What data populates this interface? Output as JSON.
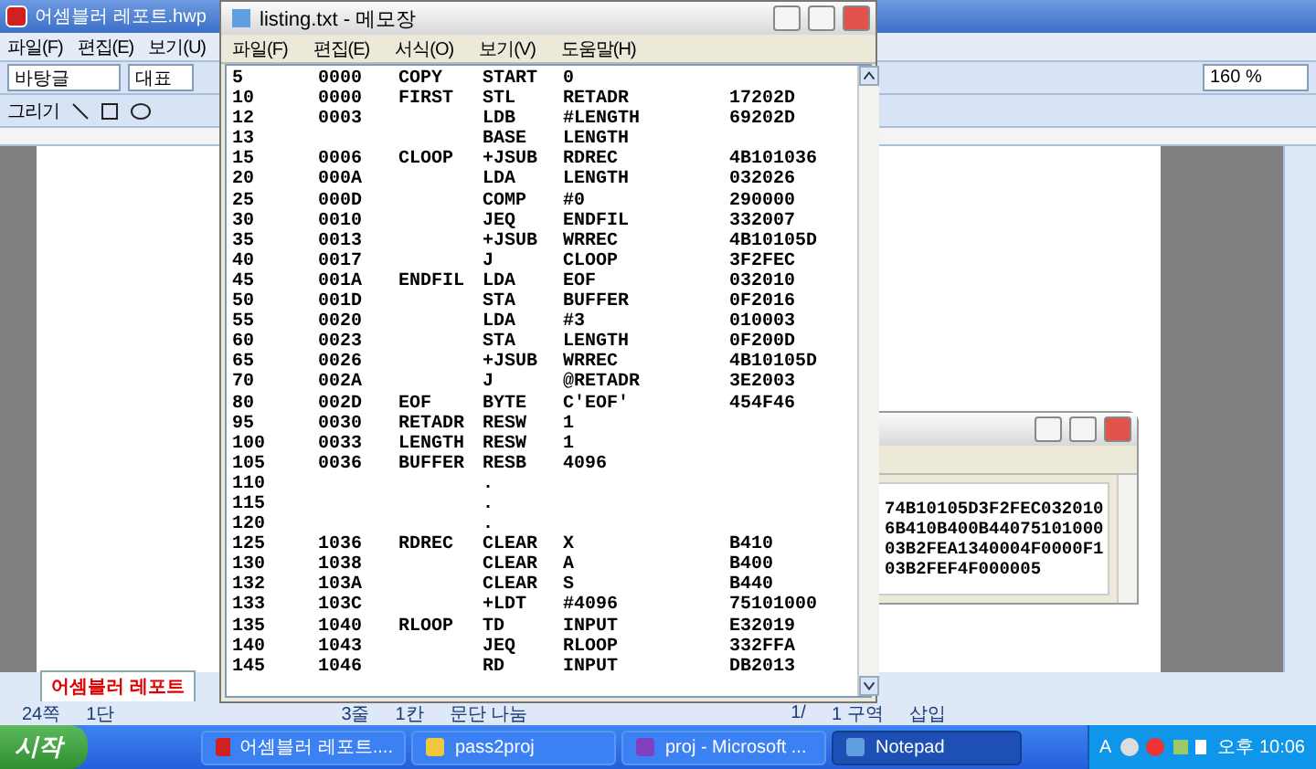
{
  "editor_window": {
    "title": "어셈블러 레포트.hwp",
    "menu": [
      "파일(F)",
      "편집(E)",
      "보기(U)"
    ],
    "style_field": "바탕글",
    "font_field": "대표",
    "draw_label": "그리기",
    "zoom_field": "160 %",
    "doc_tab": {
      "label": "어셈블러 레포트",
      "selected": true
    },
    "status_bar": [
      "24쪽",
      "1단",
      "3줄",
      "1칸",
      "문단 나눔",
      "1/",
      "1 구역",
      "삽입"
    ]
  },
  "notepad": {
    "title": "listing.txt - 메모장",
    "menu": [
      "파일(F)",
      "편집(E)",
      "서식(O)",
      "보기(V)",
      "도움말(H)"
    ],
    "rows": [
      {
        "line": "5",
        "loc": "0000",
        "label": "COPY",
        "op": "START",
        "operand": "0"
      },
      {
        "line": "10",
        "loc": "0000",
        "label": "FIRST",
        "op": "STL",
        "operand": "RETADR",
        "object_code": "17202D"
      },
      {
        "line": "12",
        "loc": "0003",
        "op": "LDB",
        "operand": "#LENGTH",
        "object_code": "69202D"
      },
      {
        "line": "13",
        "op": "BASE",
        "operand": "LENGTH"
      },
      {
        "line": "15",
        "loc": "0006",
        "label": "CLOOP",
        "op": "+JSUB",
        "operand": "RDREC",
        "object_code": "4B101036"
      },
      {
        "line": "20",
        "loc": "000A",
        "op": "LDA",
        "operand": "LENGTH",
        "object_code": "032026"
      },
      {
        "line": "25",
        "loc": "000D",
        "op": "COMP",
        "operand": "#0",
        "object_code": "290000"
      },
      {
        "line": "30",
        "loc": "0010",
        "op": "JEQ",
        "operand": "ENDFIL",
        "object_code": "332007"
      },
      {
        "line": "35",
        "loc": "0013",
        "op": "+JSUB",
        "operand": "WRREC",
        "object_code": "4B10105D"
      },
      {
        "line": "40",
        "loc": "0017",
        "op": "J",
        "operand": "CLOOP",
        "object_code": "3F2FEC"
      },
      {
        "line": "45",
        "loc": "001A",
        "label": "ENDFIL",
        "op": "LDA",
        "operand": "EOF",
        "object_code": "032010"
      },
      {
        "line": "50",
        "loc": "001D",
        "op": "STA",
        "operand": "BUFFER",
        "object_code": "0F2016"
      },
      {
        "line": "55",
        "loc": "0020",
        "op": "LDA",
        "operand": "#3",
        "object_code": "010003"
      },
      {
        "line": "60",
        "loc": "0023",
        "op": "STA",
        "operand": "LENGTH",
        "object_code": "0F200D"
      },
      {
        "line": "65",
        "loc": "0026",
        "op": "+JSUB",
        "operand": "WRREC",
        "object_code": "4B10105D"
      },
      {
        "line": "70",
        "loc": "002A",
        "op": "J",
        "operand": "@RETADR",
        "object_code": "3E2003"
      },
      {
        "line": "80",
        "loc": "002D",
        "label": "EOF",
        "op": "BYTE",
        "operand": "C'EOF'",
        "object_code": "454F46"
      },
      {
        "line": "95",
        "loc": "0030",
        "label": "RETADR",
        "op": "RESW",
        "operand": "1"
      },
      {
        "line": "100",
        "loc": "0033",
        "label": "LENGTH",
        "op": "RESW",
        "operand": "1"
      },
      {
        "line": "105",
        "loc": "0036",
        "label": "BUFFER",
        "op": "RESB",
        "operand": "4096"
      },
      {
        "line": "110",
        "op": "."
      },
      {
        "line": "115",
        "op": "."
      },
      {
        "line": "120",
        "op": "."
      },
      {
        "line": "125",
        "loc": "1036",
        "label": "RDREC",
        "op": "CLEAR",
        "operand": "X",
        "object_code": "B410"
      },
      {
        "line": "130",
        "loc": "1038",
        "op": "CLEAR",
        "operand": "A",
        "object_code": "B400"
      },
      {
        "line": "132",
        "loc": "103A",
        "op": "CLEAR",
        "operand": "S",
        "object_code": "B440"
      },
      {
        "line": "133",
        "loc": "103C",
        "op": "+LDT",
        "operand": "#4096",
        "object_code": "75101000"
      },
      {
        "line": "135",
        "loc": "1040",
        "label": "RLOOP",
        "op": "TD",
        "operand": "INPUT",
        "object_code": "E32019"
      },
      {
        "line": "140",
        "loc": "1043",
        "op": "JEQ",
        "operand": "RLOOP",
        "object_code": "332FFA"
      },
      {
        "line": "145",
        "loc": "1046",
        "op": "RD",
        "operand": "INPUT",
        "object_code": "DB2013"
      }
    ]
  },
  "output_window": {
    "lines": [
      "74B10105D3F2FEC032010",
      "6B410B400B44075101000",
      "03B2FEA1340004F0000F1",
      "03B2FEF4F000005"
    ]
  },
  "taskbar": {
    "start": "시작",
    "tasks": [
      {
        "kind": "hwp",
        "label": "어셈블러 레포트....",
        "selected": false
      },
      {
        "kind": "folder",
        "label": "pass2proj",
        "selected": false
      },
      {
        "kind": "word",
        "label": "proj - Microsoft ...",
        "selected": false
      },
      {
        "kind": "notepad",
        "label": "Notepad",
        "selected": true
      }
    ],
    "ime_label": "A",
    "clock": "오후 10:06"
  }
}
